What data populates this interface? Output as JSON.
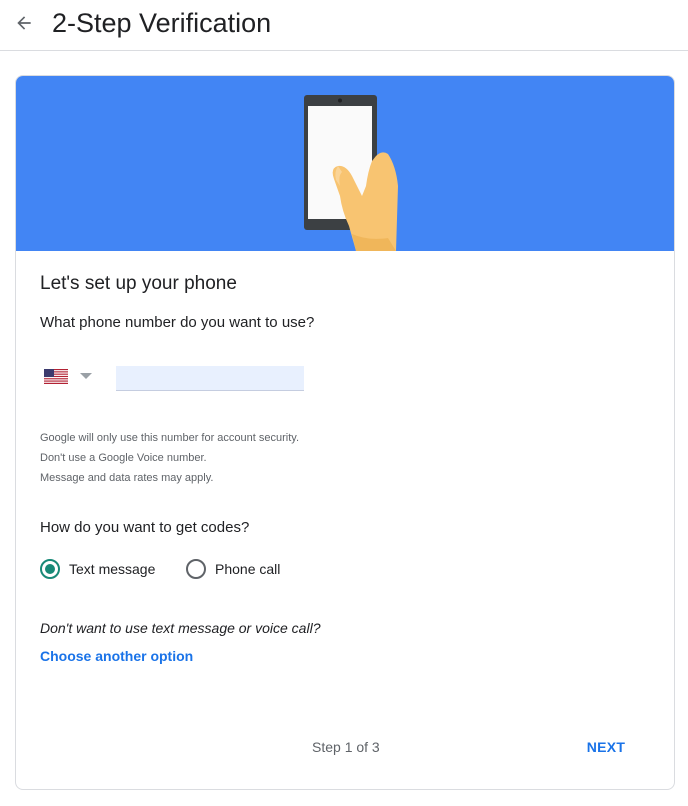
{
  "header": {
    "title": "2-Step Verification",
    "back_icon": "arrow-back-icon"
  },
  "hero": {
    "background": "#4285f4",
    "illustration": "hand-holding-phone"
  },
  "setup": {
    "heading": "Let's set up your phone",
    "phone_question": "What phone number do you want to use?",
    "country": {
      "selected": "United States",
      "flag_icon": "us-flag-icon",
      "caret_icon": "caret-down-icon"
    },
    "phone_input": {
      "value": "",
      "placeholder": ""
    },
    "notes": [
      "Google will only use this number for account security.",
      "Don't use a Google Voice number.",
      "Message and data rates may apply."
    ],
    "codes_question": "How do you want to get codes?",
    "options": [
      {
        "label": "Text message",
        "selected": true
      },
      {
        "label": "Phone call",
        "selected": false
      }
    ],
    "alternative_question": "Don't want to use text message or voice call?",
    "alternative_link": "Choose another option"
  },
  "footer": {
    "step": "Step 1 of 3",
    "next_label": "NEXT"
  },
  "colors": {
    "accent": "#1a73e8",
    "radio_selected": "#188977",
    "input_bg": "#e8f0fe"
  }
}
